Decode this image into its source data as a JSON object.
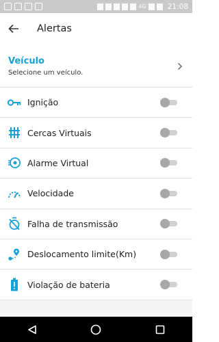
{
  "status_bar": {
    "time": "21:08",
    "network": "4G"
  },
  "header": {
    "title": "Alertas",
    "back_icon": "arrow-left-icon"
  },
  "vehicle": {
    "label": "Veículo",
    "hint": "Selecione um veículo."
  },
  "colors": {
    "accent": "#18a0d8",
    "toggle_off_thumb": "#a8a8a8",
    "toggle_off_track": "#d0d0d0"
  },
  "alerts": [
    {
      "label": "Ignição",
      "icon": "key-icon",
      "enabled": false
    },
    {
      "label": "Cercas Virtuais",
      "icon": "fence-icon",
      "enabled": false
    },
    {
      "label": "Alarme Virtual",
      "icon": "alarm-icon",
      "enabled": false
    },
    {
      "label": "Velocidade",
      "icon": "speedometer-icon",
      "enabled": false
    },
    {
      "label": "Falha de transmissão",
      "icon": "timer-off-icon",
      "enabled": false
    },
    {
      "label": "Deslocamento limite(Km)",
      "icon": "location-route-icon",
      "enabled": false
    },
    {
      "label": "Violação de bateria",
      "icon": "battery-alert-icon",
      "enabled": false
    }
  ]
}
